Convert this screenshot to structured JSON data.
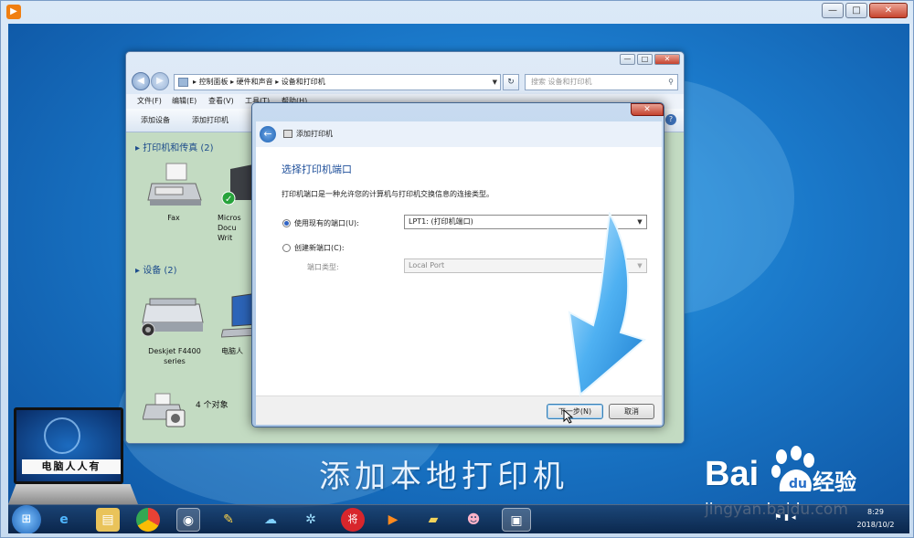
{
  "outer_window": {
    "minimize": "—",
    "maximize": "□",
    "close": "✕"
  },
  "explorer": {
    "address": {
      "crumbs": [
        "控制面板",
        "硬件和声音",
        "设备和打印机"
      ],
      "separator": "▸"
    },
    "search_placeholder": "搜索 设备和打印机",
    "menu": [
      "文件(F)",
      "编辑(E)",
      "查看(V)",
      "工具(T)",
      "帮助(H)"
    ],
    "toolbar": [
      "添加设备",
      "添加打印机"
    ],
    "groups": {
      "printers": "打印机和传真 (2)",
      "devices": "设备 (2)"
    },
    "printers": [
      {
        "label": "Fax"
      },
      {
        "label": "Micros\nDocu\nWrit"
      }
    ],
    "devices": [
      {
        "label": "Deskjet F4400\nseries"
      },
      {
        "label": "电脑人"
      }
    ],
    "object_count": "4 个对象"
  },
  "dialog": {
    "title": "添加打印机",
    "close": "✕",
    "heading": "选择打印机端口",
    "description": "打印机端口是一种允许您的计算机与打印机交换信息的连接类型。",
    "use_existing_label": "使用现有的端口(U):",
    "use_existing_value": "LPT1: (打印机端口)",
    "create_new_label": "创建新端口(C):",
    "port_type_label": "端口类型:",
    "port_type_value": "Local Port",
    "next_button": "下一步(N)",
    "cancel_button": "取消"
  },
  "overlay": {
    "caption": "添加本地打印机",
    "laptop_label": "电脑人人有",
    "baidu_logo": "Bai",
    "baidu_jingyan": "经验",
    "baidu_url": "jingyan.baidu.com"
  },
  "taskbar": {
    "clock_time": "8:29",
    "clock_date": "2018/10/2",
    "icons": [
      "ie-icon",
      "folder-icon",
      "chrome-icon",
      "app-icon",
      "paint-icon",
      "cloud-icon",
      "pinwheel-icon",
      "game-icon",
      "player-icon",
      "note-icon",
      "pig-icon",
      "devices-icon"
    ]
  },
  "colors": {
    "dialog_heading": "#1e4f9a",
    "group_heading": "#1d4c8c",
    "arrow": "#3aa0ee"
  }
}
